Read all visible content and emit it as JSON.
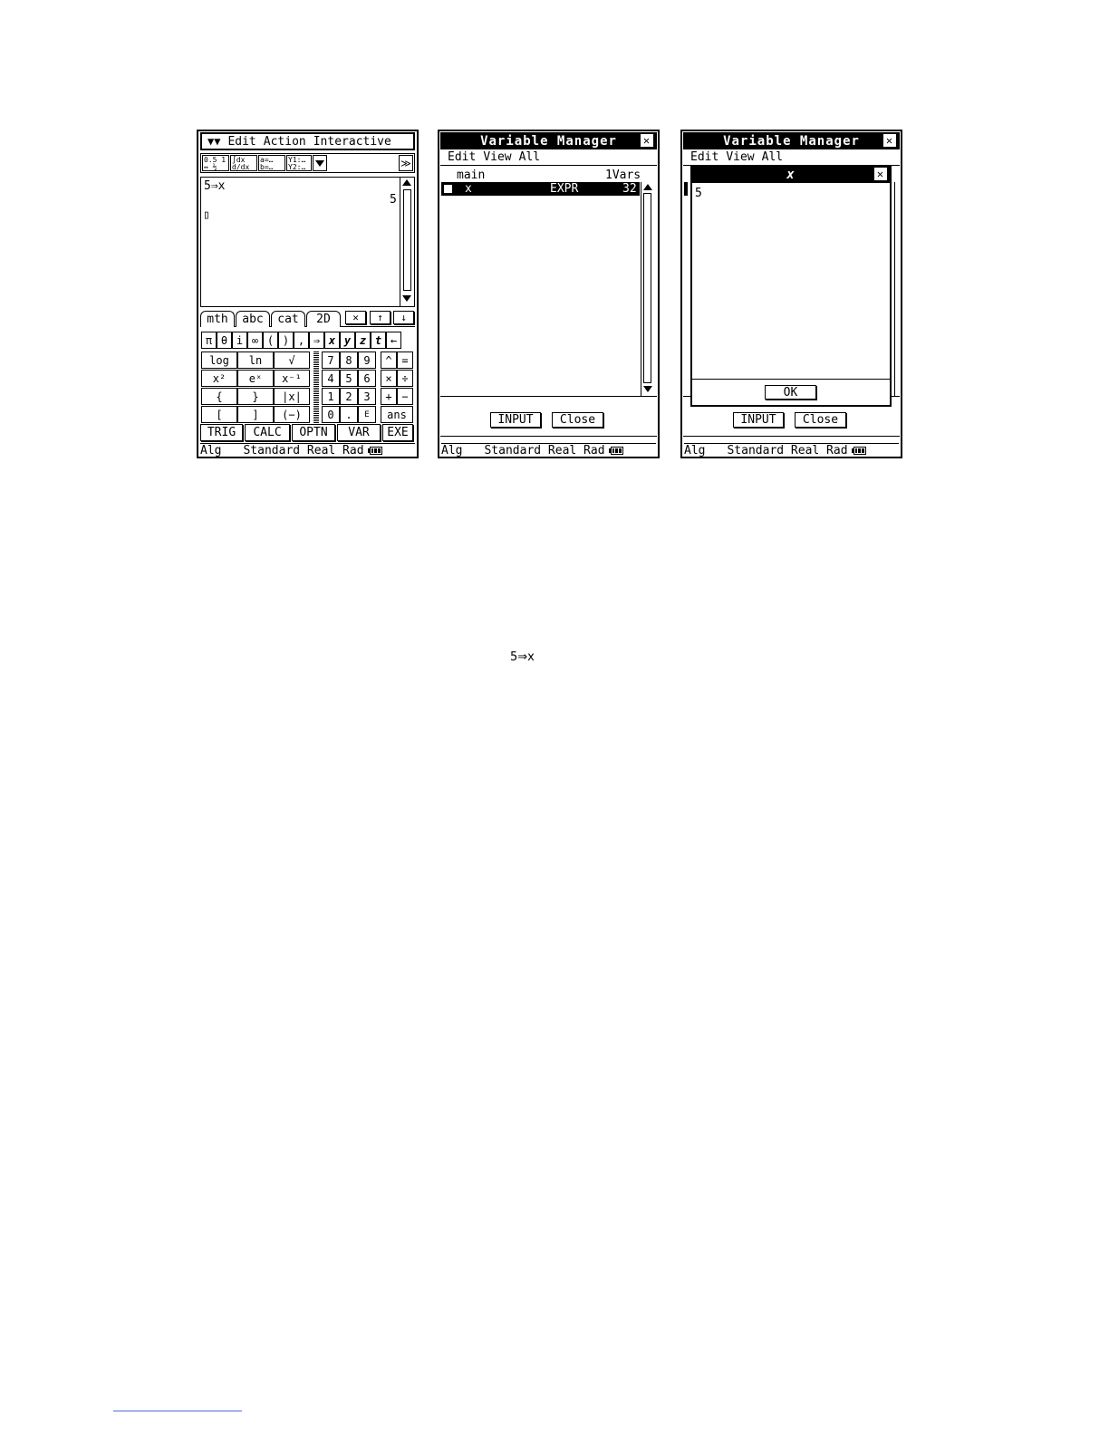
{
  "screen1": {
    "menu": {
      "icon": "double-chevron-down-icon",
      "items": [
        "Edit",
        "Action",
        "Interactive"
      ]
    },
    "toolbar": {
      "icons": [
        "decimal-toggle-icon",
        "integral-icon",
        "simultaneous-eq-icon",
        "function-icon"
      ],
      "more": "≫"
    },
    "work": {
      "input_expr": "5⇒x",
      "output": "5",
      "cursor": "▯"
    },
    "tabs": [
      "mth",
      "abc",
      "cat",
      "2D"
    ],
    "tab_icons": [
      "clear-icon",
      "up-arrow-icon",
      "down-arrow-icon"
    ],
    "symbol_row": [
      "π",
      "θ",
      "i",
      "∞",
      "(",
      ")",
      ",",
      "⇒",
      "x",
      "y",
      "z",
      "t",
      "←"
    ],
    "func_keys": [
      [
        "log",
        "ln",
        "√"
      ],
      [
        "x²",
        "eˣ",
        "x⁻¹"
      ],
      [
        "{",
        "}",
        "|x|"
      ],
      [
        "[",
        "]",
        "(−)"
      ]
    ],
    "num_keys": [
      [
        "7",
        "8",
        "9"
      ],
      [
        "4",
        "5",
        "6"
      ],
      [
        "1",
        "2",
        "3"
      ],
      [
        "0",
        ".",
        "E"
      ]
    ],
    "op_keys": [
      [
        "^",
        "="
      ],
      [
        "×",
        "÷"
      ],
      [
        "+",
        "−"
      ]
    ],
    "ans_key": "ans",
    "bottom_keys": [
      "TRIG",
      "CALC",
      "OPTN",
      "VAR",
      "EXE"
    ],
    "status": {
      "mode": "Alg",
      "settings": "Standard Real Rad"
    }
  },
  "screen2": {
    "title": "Variable Manager",
    "menu": [
      "Edit",
      "View",
      "All"
    ],
    "folder": {
      "name": "main",
      "count": "1Vars"
    },
    "rows": [
      {
        "name": "x",
        "type": "EXPR",
        "size": "32"
      }
    ],
    "buttons": {
      "input": "INPUT",
      "close": "Close"
    },
    "status": {
      "mode": "Alg",
      "settings": "Standard Real Rad"
    }
  },
  "screen3": {
    "title": "Variable Manager",
    "menu": [
      "Edit",
      "View",
      "All"
    ],
    "dialog": {
      "title": "x",
      "content": "5",
      "ok": "OK"
    },
    "buttons": {
      "input": "INPUT",
      "close": "Close"
    },
    "status": {
      "mode": "Alg",
      "settings": "Standard Real Rad"
    }
  },
  "caption": "5⇒x"
}
